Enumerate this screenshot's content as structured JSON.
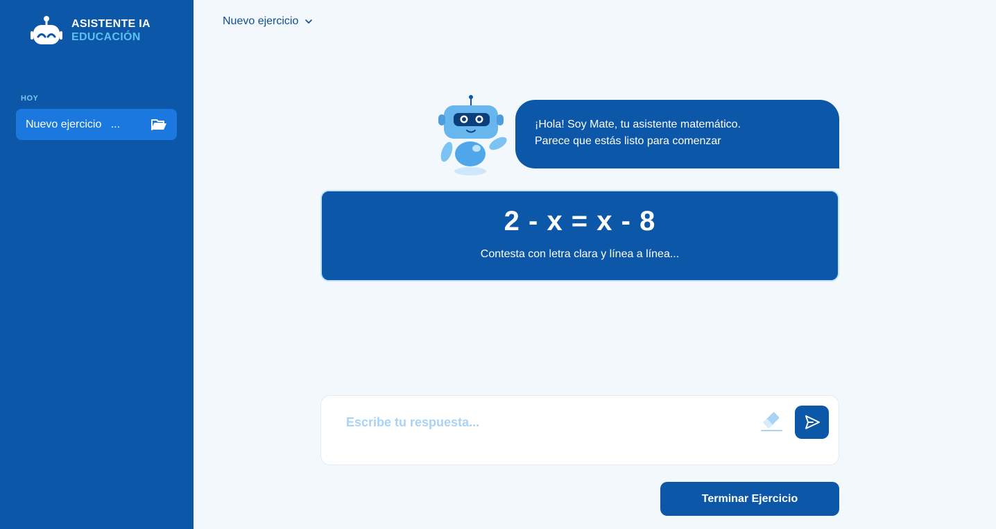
{
  "app": {
    "logo_line1": "ASISTENTE IA",
    "logo_line2": "EDUCACIÓN",
    "logo_icon": "robot-head-icon"
  },
  "sidebar": {
    "section_label": "HOY",
    "items": [
      {
        "label": "Nuevo ejercicio   ...",
        "icon": "folder-open-icon",
        "active": true
      }
    ]
  },
  "header": {
    "title": "Nuevo ejercicio",
    "icon": "chevron-down-icon"
  },
  "assistant": {
    "mascot": "robot-mascot",
    "message_line1": "¡Hola! Soy Mate, tu asistente matemático.",
    "message_line2": "Parece que estás listo para comenzar"
  },
  "exercise": {
    "equation": "2 - x = x - 8",
    "instructions": "Contesta con letra clara y línea a línea..."
  },
  "answer": {
    "placeholder": "Escribe tu respuesta...",
    "value": "",
    "eraser_icon": "eraser-icon",
    "send_icon": "send-icon"
  },
  "actions": {
    "finish_label": "Terminar Ejercicio"
  },
  "colors": {
    "primary": "#0c57a7",
    "sidebar_active": "#1a78de",
    "accent": "#5cc0f2",
    "background": "#f3f8fd"
  }
}
